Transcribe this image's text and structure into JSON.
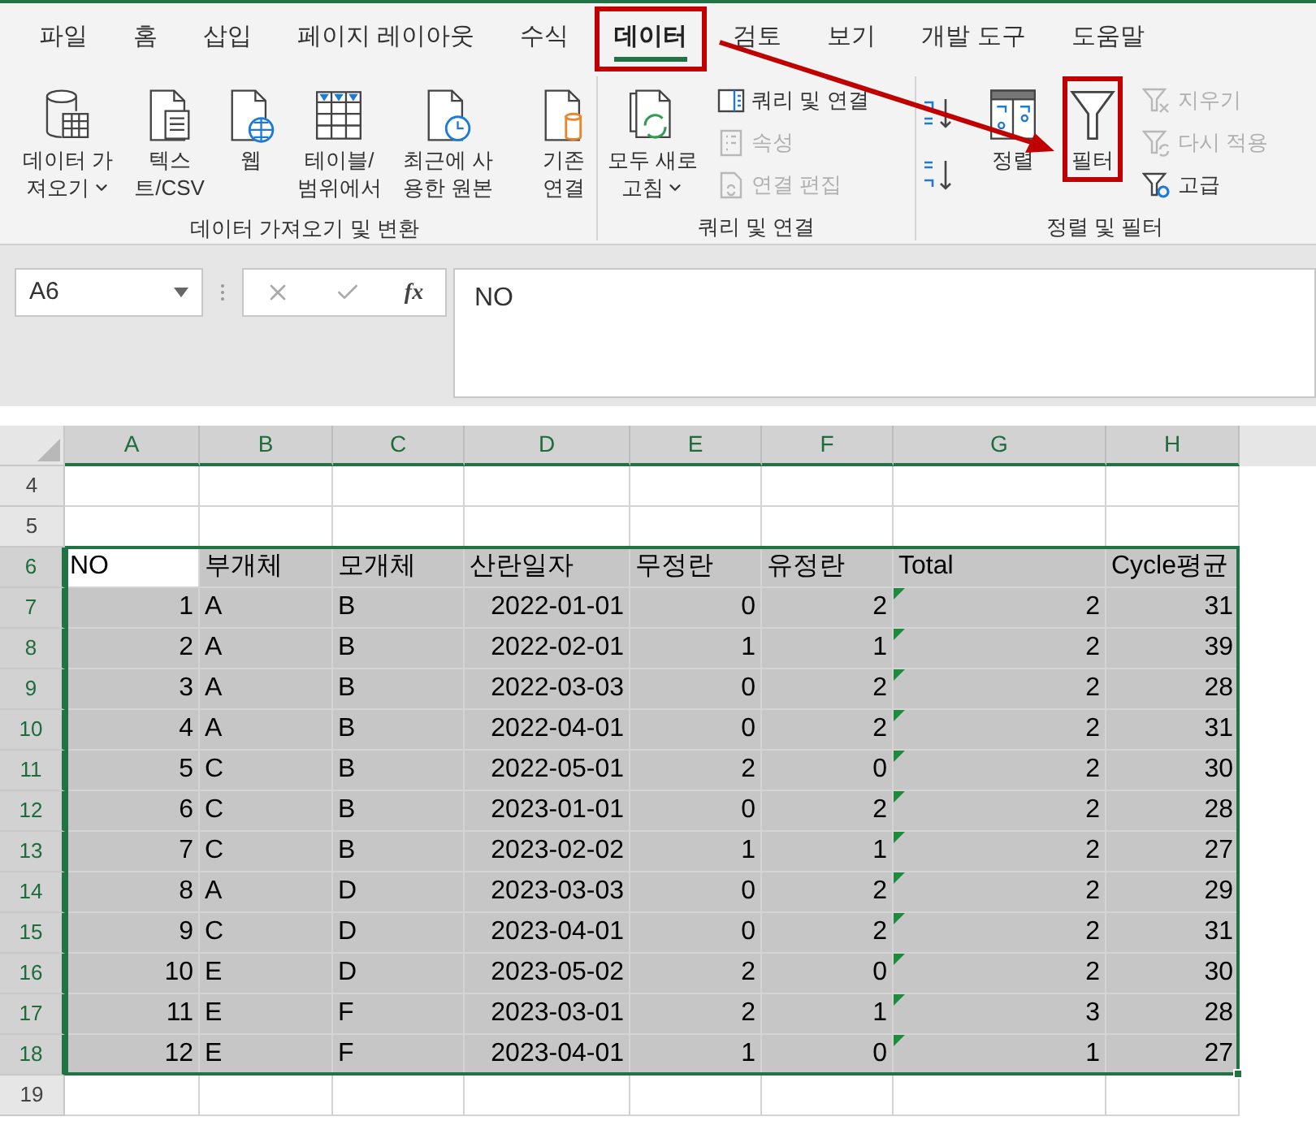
{
  "tabs": [
    {
      "label": "파일",
      "selected": false,
      "highlighted": false
    },
    {
      "label": "홈",
      "selected": false,
      "highlighted": false
    },
    {
      "label": "삽입",
      "selected": false,
      "highlighted": false
    },
    {
      "label": "페이지 레이아웃",
      "selected": false,
      "highlighted": false
    },
    {
      "label": "수식",
      "selected": false,
      "highlighted": false
    },
    {
      "label": "데이터",
      "selected": true,
      "highlighted": true
    },
    {
      "label": "검토",
      "selected": false,
      "highlighted": false
    },
    {
      "label": "보기",
      "selected": false,
      "highlighted": false
    },
    {
      "label": "개발 도구",
      "selected": false,
      "highlighted": false
    },
    {
      "label": "도움말",
      "selected": false,
      "highlighted": false
    }
  ],
  "ribbon": [
    {
      "name": "데이터 가져오기 및 변환",
      "items": [
        {
          "kind": "large",
          "lines": [
            "데이터 가",
            "져오기"
          ],
          "dropdown": true,
          "highlighted": false
        },
        {
          "kind": "large",
          "lines": [
            "텍스",
            "트/CSV"
          ],
          "dropdown": false,
          "highlighted": false
        },
        {
          "kind": "large",
          "lines": [
            "웹"
          ],
          "dropdown": false,
          "highlighted": false
        },
        {
          "kind": "large",
          "lines": [
            "테이블/",
            "범위에서"
          ],
          "dropdown": false,
          "highlighted": false
        },
        {
          "kind": "large",
          "lines": [
            "최근에 사",
            "용한 원본"
          ],
          "dropdown": false,
          "highlighted": false
        },
        {
          "kind": "separator"
        },
        {
          "kind": "large",
          "lines": [
            "기존",
            "연결"
          ],
          "dropdown": false,
          "highlighted": false
        }
      ]
    },
    {
      "name": "쿼리 및 연결",
      "items": [
        {
          "kind": "large",
          "lines": [
            "모두 새로",
            "고침"
          ],
          "dropdown": true,
          "highlighted": false
        },
        {
          "kind": "stack",
          "items": [
            {
              "label": "쿼리 및 연결",
              "disabled": false
            },
            {
              "label": "속성",
              "disabled": true
            },
            {
              "label": "연결 편집",
              "disabled": true
            }
          ]
        }
      ]
    },
    {
      "name": "정렬 및 필터",
      "items": [
        {
          "kind": "sortpair"
        },
        {
          "kind": "large",
          "lines": [
            "정렬"
          ],
          "dropdown": false,
          "highlighted": false
        },
        {
          "kind": "large",
          "lines": [
            "필터"
          ],
          "dropdown": false,
          "highlighted": true
        },
        {
          "kind": "stack",
          "items": [
            {
              "label": "지우기",
              "disabled": true
            },
            {
              "label": "다시 적용",
              "disabled": true
            },
            {
              "label": "고급",
              "disabled": false
            }
          ]
        }
      ]
    }
  ],
  "formula_bar": {
    "name_box": "A6",
    "function_label": "fx",
    "formula": "NO"
  },
  "sheet": {
    "columns": [
      {
        "letter": "A",
        "error_marks": false
      },
      {
        "letter": "B",
        "error_marks": false
      },
      {
        "letter": "C",
        "error_marks": false
      },
      {
        "letter": "D",
        "error_marks": false
      },
      {
        "letter": "E",
        "error_marks": false
      },
      {
        "letter": "F",
        "error_marks": false
      },
      {
        "letter": "G",
        "error_marks": true
      },
      {
        "letter": "H",
        "error_marks": false
      }
    ],
    "rows": [
      {
        "number": "4",
        "kind": "empty",
        "selected": false,
        "cells": []
      },
      {
        "number": "5",
        "kind": "empty",
        "selected": false,
        "cells": []
      },
      {
        "number": "6",
        "kind": "header",
        "selected": true,
        "cells": [
          "NO",
          "부개체",
          "모개체",
          "산란일자",
          "무정란",
          "유정란",
          "Total",
          "Cycle평균"
        ]
      },
      {
        "number": "7",
        "kind": "data",
        "selected": true,
        "cells": [
          "1",
          "A",
          "B",
          "2022-01-01",
          "0",
          "2",
          "2",
          "31"
        ]
      },
      {
        "number": "8",
        "kind": "data",
        "selected": true,
        "cells": [
          "2",
          "A",
          "B",
          "2022-02-01",
          "1",
          "1",
          "2",
          "39"
        ]
      },
      {
        "number": "9",
        "kind": "data",
        "selected": true,
        "cells": [
          "3",
          "A",
          "B",
          "2022-03-03",
          "0",
          "2",
          "2",
          "28"
        ]
      },
      {
        "number": "10",
        "kind": "data",
        "selected": true,
        "cells": [
          "4",
          "A",
          "B",
          "2022-04-01",
          "0",
          "2",
          "2",
          "31"
        ]
      },
      {
        "number": "11",
        "kind": "data",
        "selected": true,
        "cells": [
          "5",
          "C",
          "B",
          "2022-05-01",
          "2",
          "0",
          "2",
          "30"
        ]
      },
      {
        "number": "12",
        "kind": "data",
        "selected": true,
        "cells": [
          "6",
          "C",
          "B",
          "2023-01-01",
          "0",
          "2",
          "2",
          "28"
        ]
      },
      {
        "number": "13",
        "kind": "data",
        "selected": true,
        "cells": [
          "7",
          "C",
          "B",
          "2023-02-02",
          "1",
          "1",
          "2",
          "27"
        ]
      },
      {
        "number": "14",
        "kind": "data",
        "selected": true,
        "cells": [
          "8",
          "A",
          "D",
          "2023-03-03",
          "0",
          "2",
          "2",
          "29"
        ]
      },
      {
        "number": "15",
        "kind": "data",
        "selected": true,
        "cells": [
          "9",
          "C",
          "D",
          "2023-04-01",
          "0",
          "2",
          "2",
          "31"
        ]
      },
      {
        "number": "16",
        "kind": "data",
        "selected": true,
        "cells": [
          "10",
          "E",
          "D",
          "2023-05-02",
          "2",
          "0",
          "2",
          "30"
        ]
      },
      {
        "number": "17",
        "kind": "data",
        "selected": true,
        "cells": [
          "11",
          "E",
          "F",
          "2023-03-01",
          "2",
          "1",
          "3",
          "28"
        ]
      },
      {
        "number": "18",
        "kind": "data",
        "selected": true,
        "cells": [
          "12",
          "E",
          "F",
          "2023-04-01",
          "1",
          "0",
          "1",
          "27"
        ]
      },
      {
        "number": "19",
        "kind": "empty",
        "selected": false,
        "cells": []
      }
    ]
  }
}
